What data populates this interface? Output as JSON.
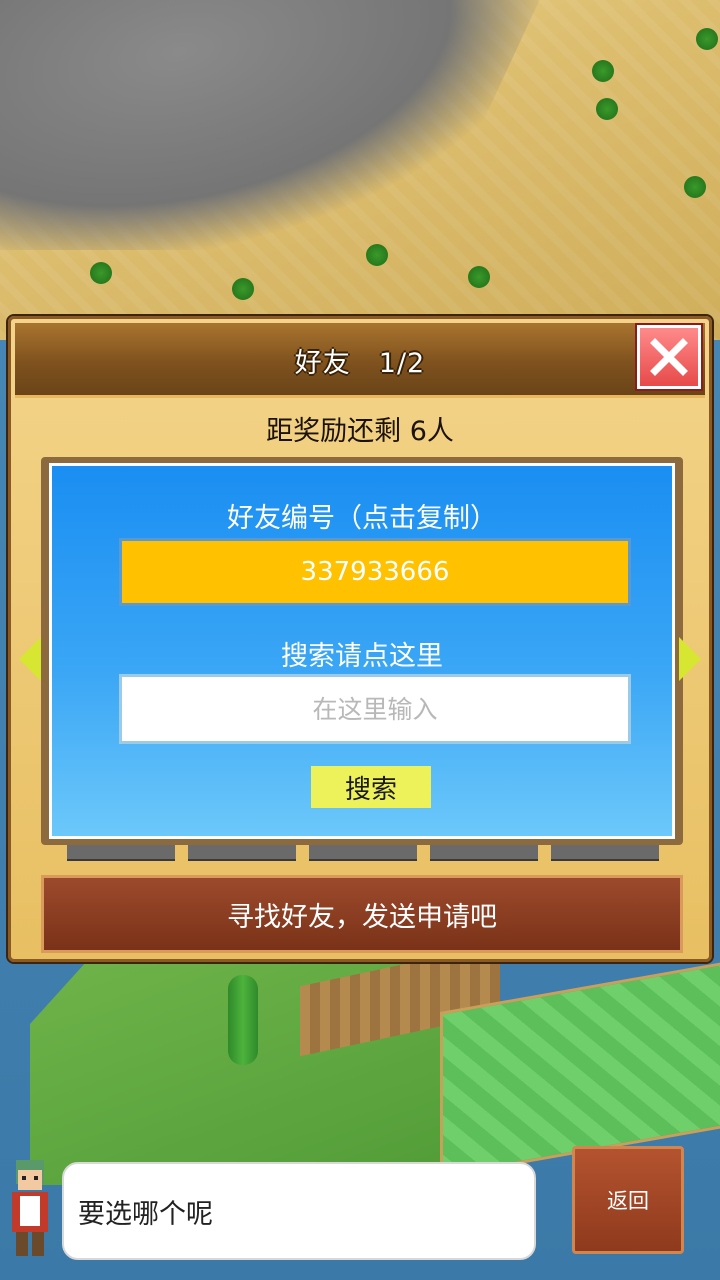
{
  "dialog": {
    "title": "好友　1/2",
    "reward_remaining": "距奖励还剩 6人",
    "friend_id_label": "好友编号（点击复制）",
    "friend_id": "337933666",
    "search_label": "搜索请点这里",
    "search_placeholder": "在这里输入",
    "search_button": "搜索",
    "find_friends_button": "寻找好友，发送申请吧"
  },
  "footer": {
    "speech_text": "要选哪个呢",
    "back_button": "返回"
  },
  "colors": {
    "friend_id_bg": "#ffc100",
    "panel_top": "#1a8ef2",
    "panel_bottom": "#6cc8fa",
    "close_button": "#e74a4a",
    "search_button_bg": "#eef25a",
    "find_button_bg": "#8a3a20"
  },
  "icons": {
    "close": "close-x-icon",
    "prev": "arrow-left-icon",
    "next": "arrow-right-icon"
  }
}
